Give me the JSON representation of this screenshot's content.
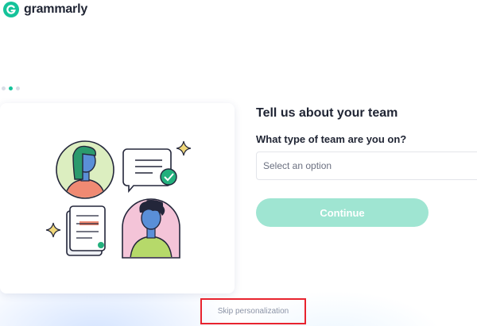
{
  "brand": {
    "name": "grammarly",
    "logo_color": "#15c39a"
  },
  "progress": {
    "total_steps": 3,
    "active_step": 2
  },
  "form": {
    "title": "Tell us about your team",
    "question": "What type of team are you on?",
    "select": {
      "placeholder": "Select an option"
    },
    "continue_label": "Continue"
  },
  "skip": {
    "label": "Skip personalization"
  },
  "colors": {
    "accent": "#15c39a",
    "button_disabled": "#9fe5d2",
    "highlight": "#e8232e"
  },
  "illustration": {
    "icons": [
      "person-green-hair-icon",
      "chat-bubble-icon",
      "checkmark-icon",
      "document-icon",
      "person-curly-hair-icon",
      "sparkle-icon"
    ]
  }
}
